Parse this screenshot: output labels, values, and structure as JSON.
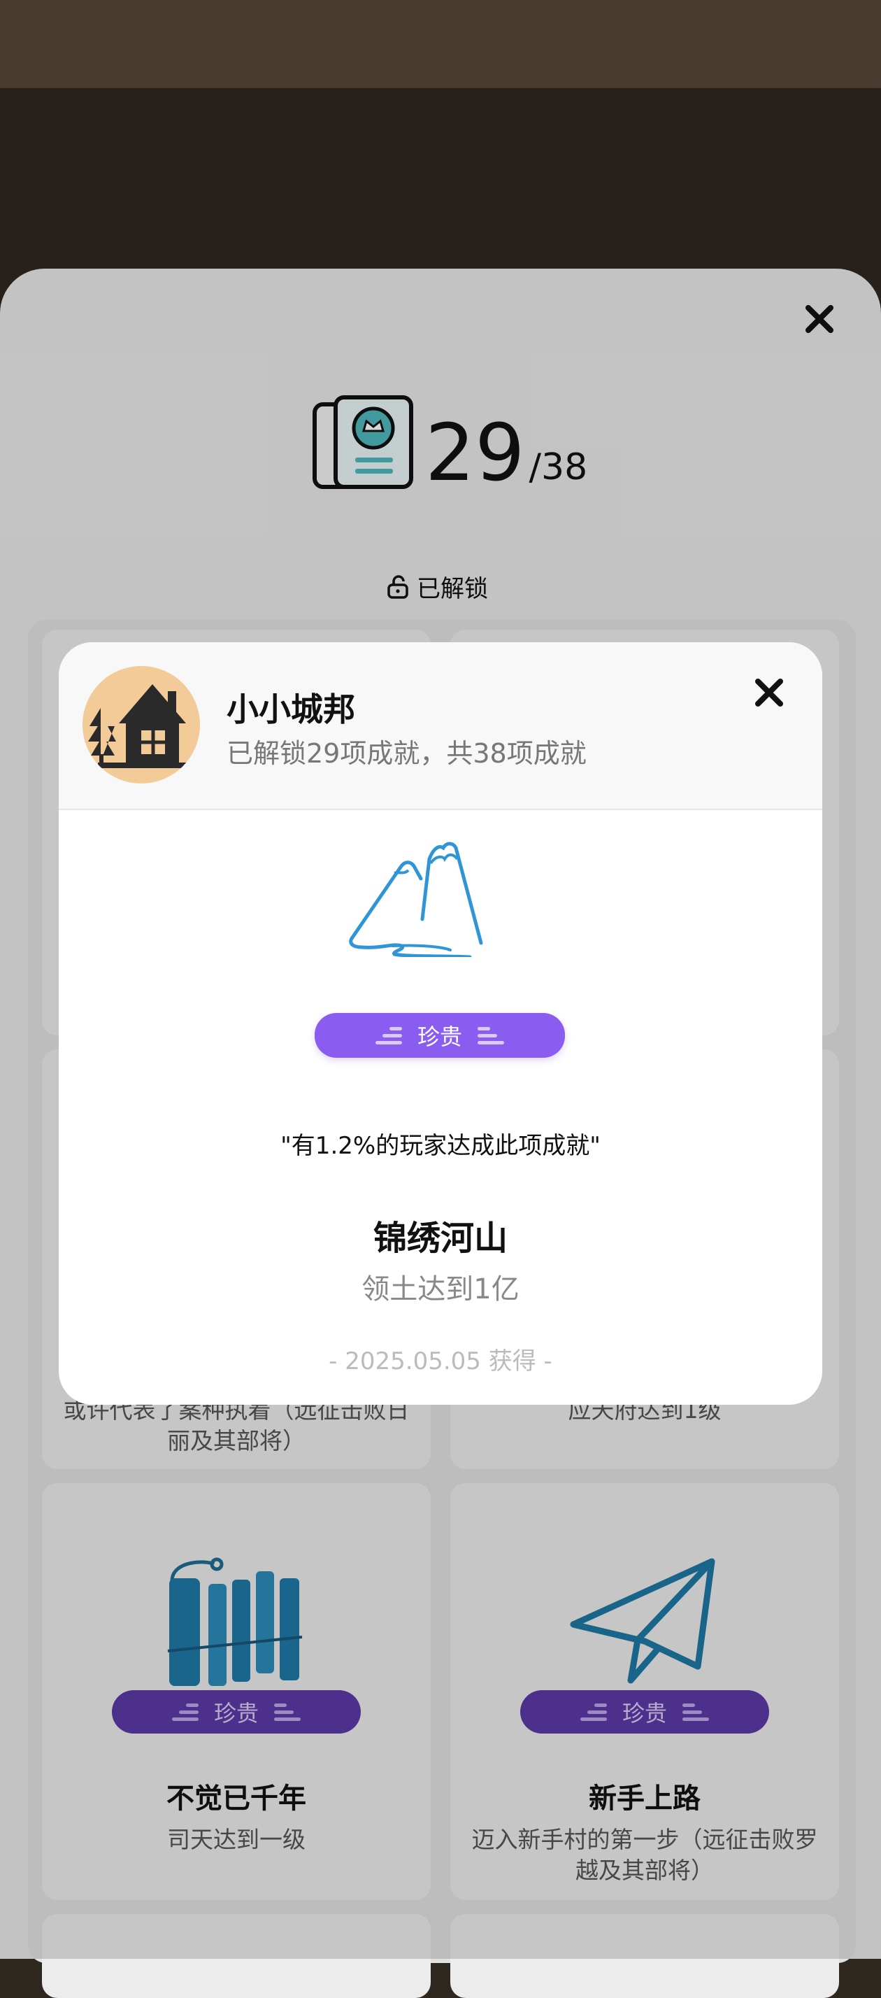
{
  "page": {
    "unlocked_count": "29",
    "total_count": "/38",
    "unlock_filter_label": "已解锁"
  },
  "cards": [
    {
      "title": "",
      "desc": "或许代表了案种执着（远征击败日丽及其部将）",
      "badge": ""
    },
    {
      "title": "",
      "desc": "应天府达到1级",
      "badge": ""
    },
    {
      "title": "不觉已千年",
      "desc": "司天达到一级",
      "badge": "珍贵",
      "icon": "bamboo-slips-icon"
    },
    {
      "title": "新手上路",
      "desc": "迈入新手村的第一步（远征击败罗越及其部将）",
      "badge": "珍贵",
      "icon": "paper-plane-icon"
    }
  ],
  "modal": {
    "game_title": "小小城邦",
    "game_subtitle": "已解锁29项成就，共38项成就",
    "rarity_badge": "珍贵",
    "percent_text": "\"有1.2%的玩家达成此项成就\"",
    "achievement_name": "锦绣河山",
    "achievement_desc": "领土达到1亿",
    "obtained_date": "- 2025.05.05 获得 -",
    "illustration_icon": "mountains-river-icon",
    "avatar_icon": "house-trees-icon"
  },
  "colors": {
    "accent_purple": "#8a5cf0",
    "dim_purple": "#5b3aa6",
    "avatar_bg": "#f2cb98",
    "mountain_blue": "#2f95d6"
  }
}
